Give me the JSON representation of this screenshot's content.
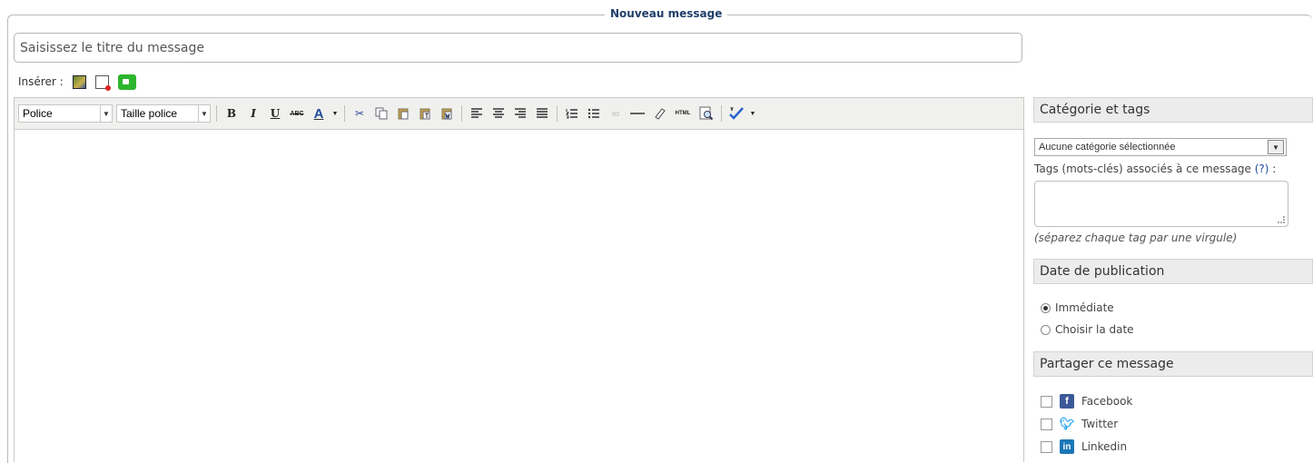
{
  "legend": "Nouveau message",
  "title_field": {
    "placeholder": "Saisissez le titre du message"
  },
  "insert": {
    "label": "Insérer :",
    "icons": [
      "image-icon",
      "document-icon",
      "video-icon"
    ]
  },
  "toolbar": {
    "font_select": "Police",
    "size_select": "Taille police",
    "bold": "B",
    "italic": "I",
    "underline": "U",
    "strike": "ABC",
    "color": "A",
    "html": "HTML"
  },
  "category_section": {
    "title": "Catégorie et tags",
    "category_select": "Aucune catégorie sélectionnée",
    "tags_label": "Tags (mots-clés) associés à ce message",
    "tags_help": "(?)",
    "tags_suffix": " :",
    "tags_hint": "(séparez chaque tag par une virgule)"
  },
  "publication_section": {
    "title": "Date de publication",
    "options": [
      {
        "label": "Immédiate",
        "selected": true
      },
      {
        "label": "Choisir la date",
        "selected": false
      }
    ]
  },
  "share_section": {
    "title": "Partager ce message",
    "networks": [
      {
        "label": "Facebook"
      },
      {
        "label": "Twitter"
      },
      {
        "label": "Linkedin"
      }
    ]
  },
  "colors": {
    "legend": "#1f3f68",
    "facebook": "#3b5998",
    "twitter": "#1da1f2",
    "linkedin": "#1b77b7"
  }
}
